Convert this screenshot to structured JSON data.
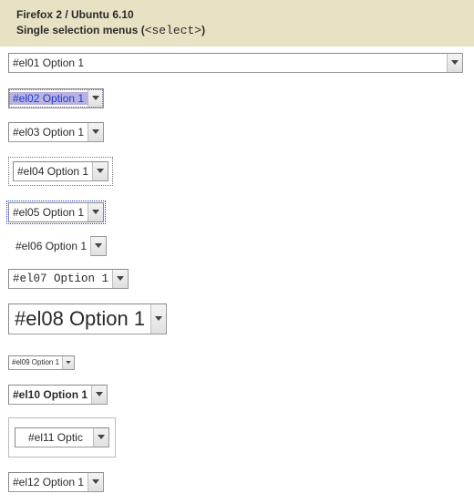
{
  "header": {
    "line1": "Firefox 2 / Ubuntu 6.10",
    "line2_prefix_bold": "Single selection menus (",
    "line2_code": "<select>",
    "line2_suffix_bold": ")"
  },
  "rows": {
    "r01": {
      "value": "#el01 Option 1"
    },
    "r02": {
      "value": "#el02 Option 1"
    },
    "r03": {
      "value": "#el03 Option 1"
    },
    "r04": {
      "value": "#el04 Option 1"
    },
    "r05": {
      "value": "#el05 Option 1"
    },
    "r06": {
      "value": "#el06 Option 1"
    },
    "r07": {
      "value": "#el07 Option 1"
    },
    "r08": {
      "value": "#el08 Option 1"
    },
    "r09": {
      "value": "#el09 Option 1"
    },
    "r10": {
      "value": "#el10 Option 1"
    },
    "r11": {
      "value": "#el11 Optic"
    },
    "r12": {
      "value": "#el12 Option 1"
    }
  }
}
